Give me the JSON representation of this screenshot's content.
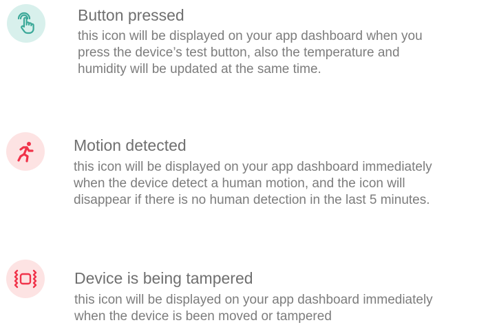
{
  "entries": [
    {
      "icon": "hand-pointer-icon",
      "icon_bg": "#d8f0ec",
      "icon_color": "#3aa898",
      "title": "Button pressed",
      "lines": [
        "this icon will be displayed on your app dashboard when you",
        "press the device’s test button, also the temperature and",
        "humidity will be updated at the same time."
      ]
    },
    {
      "icon": "running-person-icon",
      "icon_bg": "#fde3e3",
      "icon_color": "#f0334a",
      "title": "Motion detected",
      "lines": [
        "this icon will be displayed on your app dashboard immediately",
        "when the device detect a human motion, and the icon will",
        "disappear if there is no human detection in the last 5 minutes."
      ]
    },
    {
      "icon": "vibrating-device-icon",
      "icon_bg": "#fde3e3",
      "icon_color": "#f0334a",
      "title": "Device is being tampered",
      "lines": [
        "this icon will be displayed on your app dashboard immediately",
        "when the device is been moved or tampered"
      ]
    }
  ]
}
